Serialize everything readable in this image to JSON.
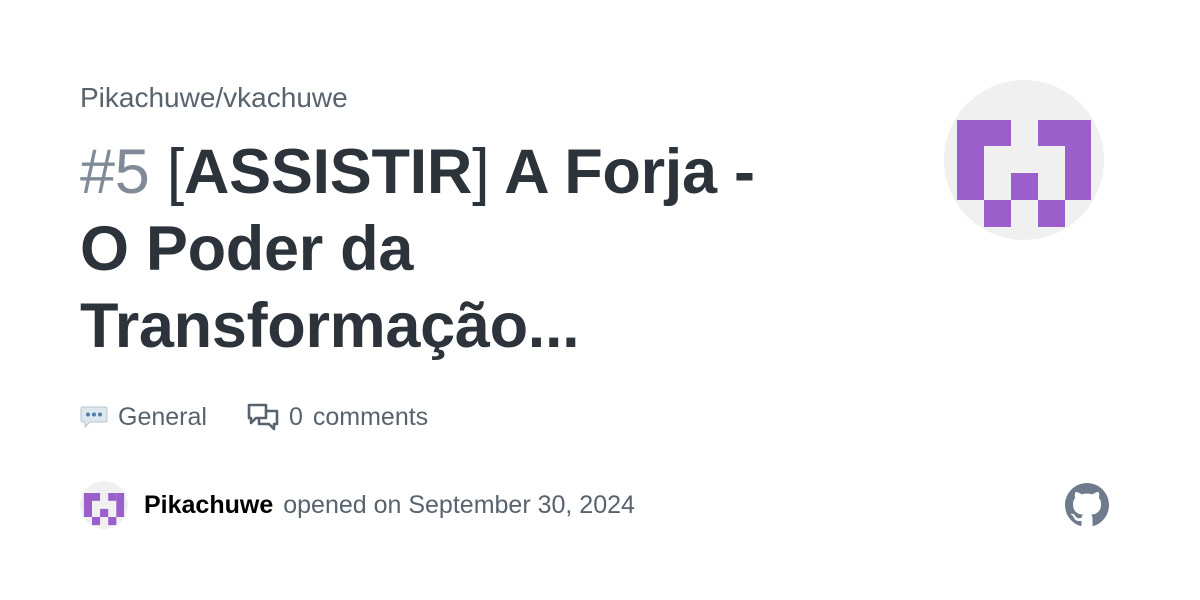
{
  "repo": "Pikachuwe/vkachuwe",
  "issue": {
    "number": "#5",
    "bracket_open": "[",
    "bracket_text": "ASSISTIR",
    "bracket_close": "]",
    "title_line1_rest": " A Forja -",
    "title_line2": "O Poder da",
    "title_line3": "Transformação..."
  },
  "meta": {
    "category_emoji_icon": "speech-bubble-dots-icon",
    "category": "General",
    "comments_icon": "comment-discussion-icon",
    "comment_count": "0",
    "comments_label": "comments"
  },
  "author_row": {
    "author": "Pikachuwe",
    "opened_text": "opened on September 30, 2024"
  },
  "colors": {
    "identicon_purple": "#9b5fcb",
    "avatar_bg": "#f0f0f0",
    "title_text": "#2c333b",
    "muted_text": "#59636e",
    "number_text": "#818b98",
    "github_logo": "#6e7b8c"
  },
  "icons": {
    "brand_logo": "github-icon"
  }
}
